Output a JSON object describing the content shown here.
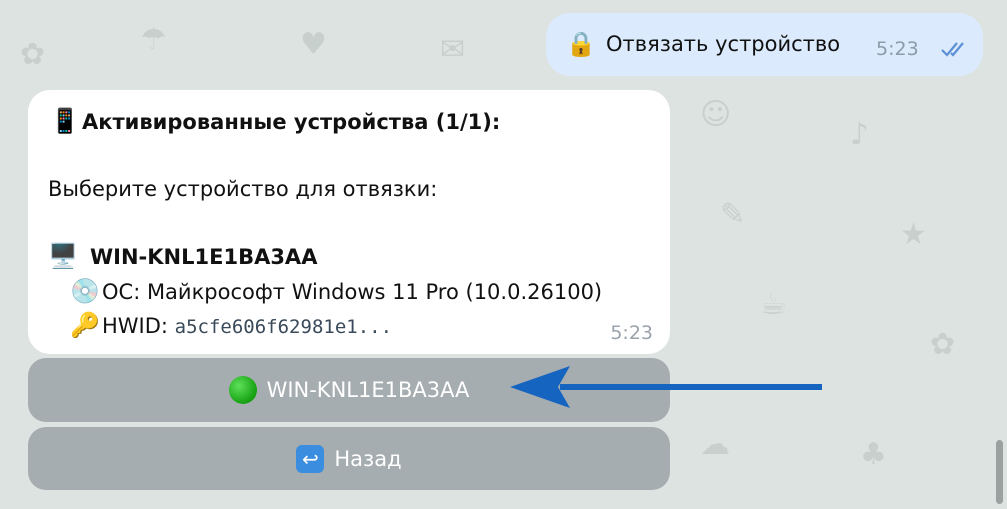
{
  "outgoing_message": {
    "icon": "lock-icon",
    "text": "Отвязать устройство",
    "time": "5:23",
    "status": "read-double-check"
  },
  "incoming_message": {
    "header_icon": "mobile-phone-icon",
    "header": "Активированные устройства (1/1):",
    "prompt": "Выберите устройство для отвязки:",
    "device": {
      "icon": "desktop-computer-icon",
      "name": "WIN-KNL1E1BA3AA",
      "os_icon": "disc-icon",
      "os_label": "ОС: Майкрософт Windows 11 Pro (10.0.26100)",
      "hwid_icon": "key-icon",
      "hwid_label": "HWID: ",
      "hwid_value": "a5cfe606f62981e1..."
    },
    "time": "5:23"
  },
  "keyboard": {
    "device_button": {
      "icon": "green-circle-icon",
      "label": "WIN-KNL1E1BA3AA"
    },
    "back_button": {
      "icon": "back-arrow-icon",
      "label": "Назад"
    }
  },
  "colors": {
    "chat_background": "#dde3e1",
    "outgoing_bubble": "#dbeafc",
    "incoming_bubble": "#ffffff",
    "annotation_arrow": "#1565c0"
  }
}
